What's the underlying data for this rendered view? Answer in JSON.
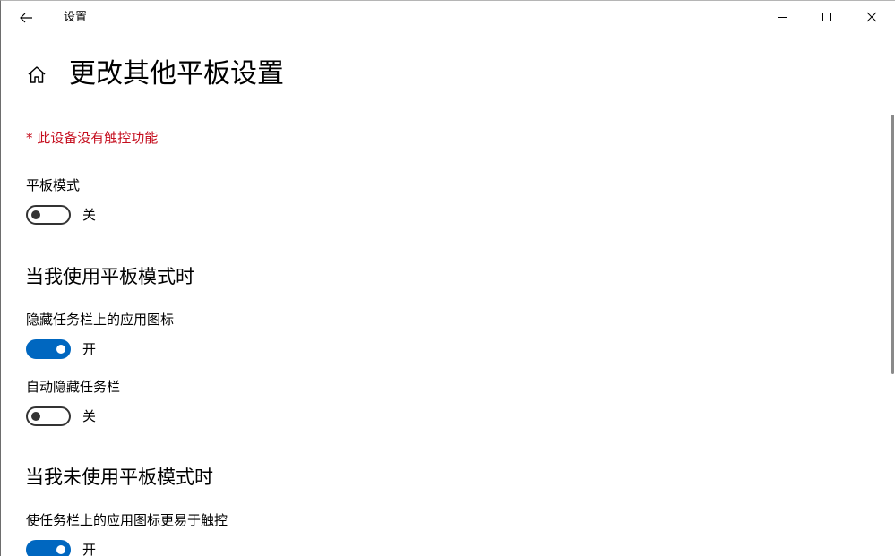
{
  "window": {
    "app_title": "设置"
  },
  "page": {
    "title": "更改其他平板设置",
    "warning": "* 此设备没有触控功能"
  },
  "settings": {
    "tablet_mode": {
      "label": "平板模式",
      "state": "关",
      "on": false
    },
    "section_in_tablet": "当我使用平板模式时",
    "hide_icons": {
      "label": "隐藏任务栏上的应用图标",
      "state": "开",
      "on": true
    },
    "auto_hide": {
      "label": "自动隐藏任务栏",
      "state": "关",
      "on": false
    },
    "section_not_tablet": "当我未使用平板模式时",
    "touch_icons": {
      "label": "使任务栏上的应用图标更易于触控",
      "state": "开",
      "on": true
    }
  },
  "colors": {
    "accent": "#0067c0",
    "warning": "#c50f1f"
  },
  "icons": {
    "back": "back-arrow-icon",
    "home": "home-icon",
    "minimize": "minimize-icon",
    "maximize": "maximize-icon",
    "close": "close-icon"
  }
}
